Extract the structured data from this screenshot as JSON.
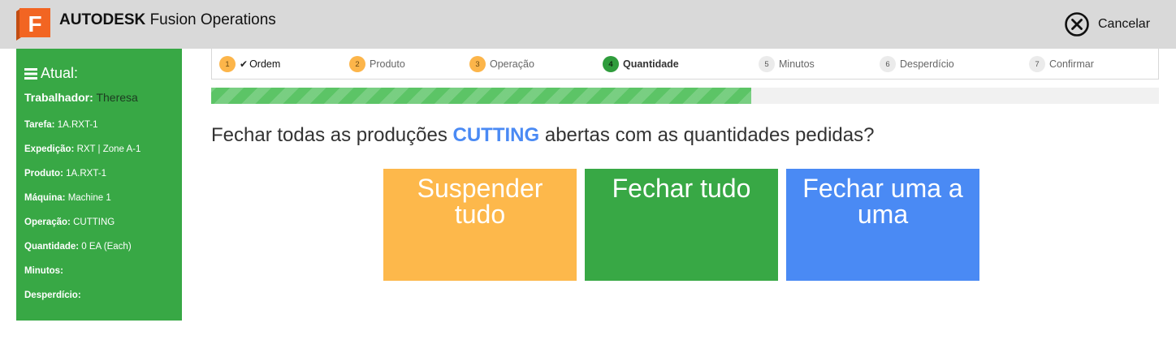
{
  "header": {
    "brand_bold": "AUTODESK",
    "brand_rest": "Fusion Operations",
    "logo_letter": "F",
    "cancel_label": "Cancelar",
    "cancel_icon": "close-circle-icon",
    "colors": {
      "background": "#d9d9d9",
      "logo": "#f26522"
    }
  },
  "sidebar": {
    "title": "Atual:",
    "worker_label": "Trabalhador",
    "worker_value": "Theresa",
    "rows": [
      {
        "label": "Tarefa:",
        "value": "1A.RXT-1"
      },
      {
        "label": "Expedição:",
        "value": "RXT | Zone A-1"
      },
      {
        "label": "Produto:",
        "value": "1A.RXT-1"
      },
      {
        "label": "Máquina:",
        "value": "Machine 1"
      },
      {
        "label": "Operação:",
        "value": "CUTTING"
      },
      {
        "label": "Quantidade:",
        "value": "0 EA (Each)"
      },
      {
        "label": "Minutos:",
        "value": ""
      },
      {
        "label": "Desperdício:",
        "value": ""
      }
    ],
    "colors": {
      "background": "#38a845"
    }
  },
  "steps": [
    {
      "num": "1",
      "label": "Ordem",
      "state": "done"
    },
    {
      "num": "2",
      "label": "Produto",
      "state": "visited"
    },
    {
      "num": "3",
      "label": "Operação",
      "state": "visited"
    },
    {
      "num": "4",
      "label": "Quantidade",
      "state": "active"
    },
    {
      "num": "5",
      "label": "Minutos",
      "state": "pending"
    },
    {
      "num": "6",
      "label": "Desperdício",
      "state": "pending"
    },
    {
      "num": "7",
      "label": "Confirmar",
      "state": "pending"
    }
  ],
  "progress": {
    "fraction": 0.57,
    "color": "#5cc466"
  },
  "question": {
    "before": "Fechar todas as produções",
    "highlight": "CUTTING",
    "after": "abertas com as quantidades pedidas?"
  },
  "actions": [
    {
      "label": "Suspender tudo",
      "color": "#fdb84b"
    },
    {
      "label": "Fechar tudo",
      "color": "#38a845"
    },
    {
      "label": "Fechar uma a uma",
      "color": "#4a8af4"
    }
  ]
}
